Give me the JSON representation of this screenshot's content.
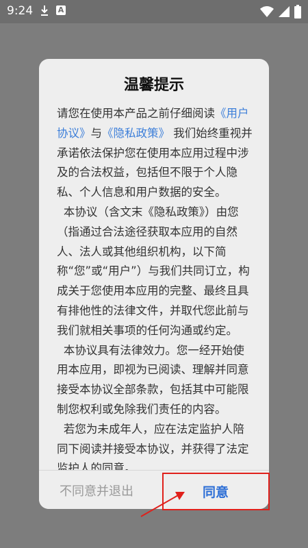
{
  "status_bar": {
    "time": "9:24",
    "icons": [
      "download-icon",
      "a-notification-icon",
      "wifi-icon",
      "signal-icon",
      "battery-icon"
    ]
  },
  "dialog": {
    "title": "温馨提示",
    "p1_before": "请您在使用本产品之前仔细阅读",
    "link_user_agreement": "《用户协议》",
    "p1_and": "与",
    "link_privacy": "《隐私政策》",
    "p1_after": " 我们始终重视并承诺依法保护您在使用本应用过程中涉及的合法权益，包括但不限于个人隐私、个人信息和用户数据的安全。",
    "p2": "本协议（含文末《隐私政策》）由您（指通过合法途径获取本应用的自然人、法人或其他组织机构，以下简称“您”或“用户”）与我们共同订立，构成关于您使用本应用的完整、最终且具有排他性的法律文件，并取代您此前与我们就相关事项的任何沟通或约定。",
    "p3": "本协议具有法律效力。您一经开始使用本应用，即视为已阅读、理解并同意接受本协议全部条款，包括其中可能限制您权利或免除我们责任的内容。",
    "p4": "若您为未成年人，应在法定监护人陪同下阅读并接受本协议，并获得了法定监护人的同意。",
    "decline_label": "不同意并退出",
    "agree_label": "同意"
  },
  "colors": {
    "link": "#3d7fd9",
    "agree": "#2e6fd6",
    "highlight": "#e0201b"
  }
}
